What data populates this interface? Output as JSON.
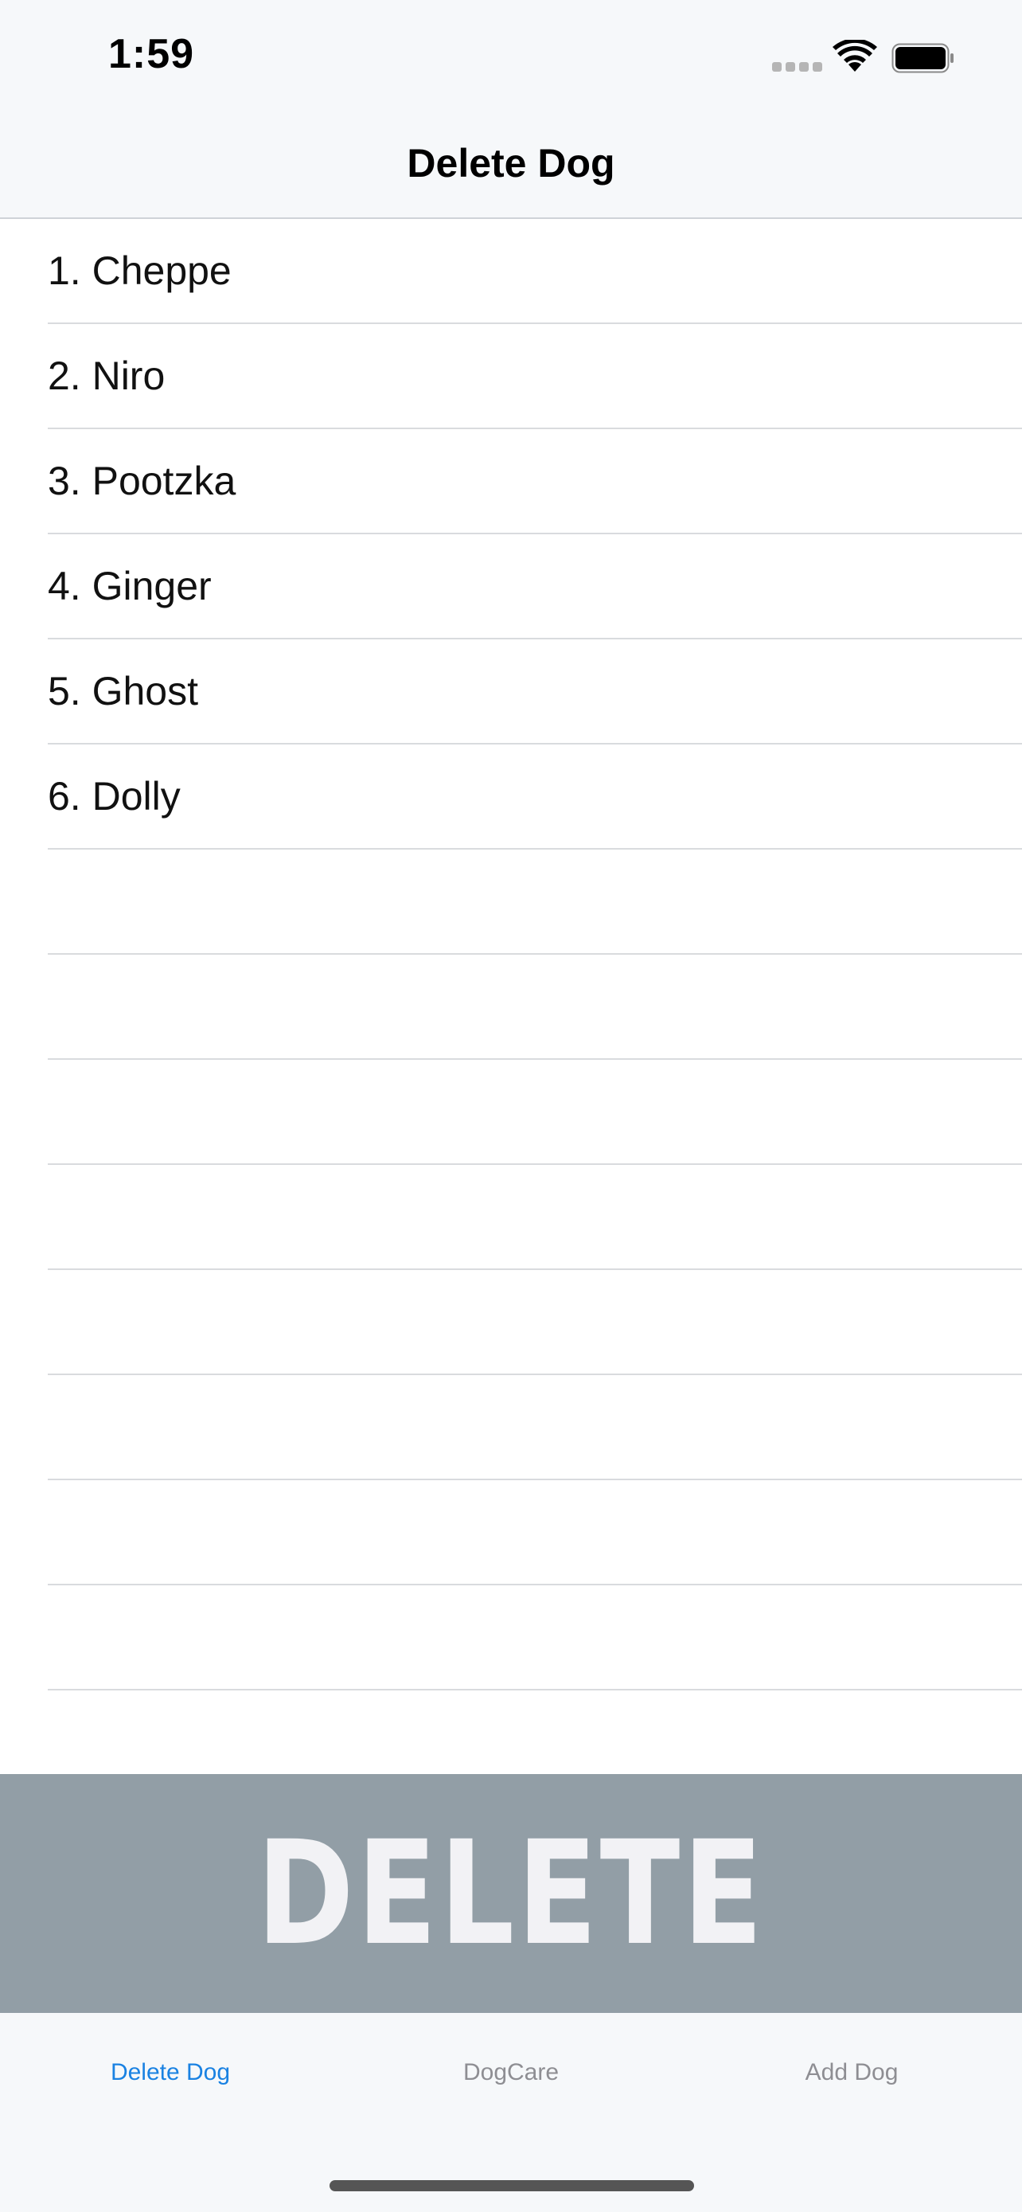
{
  "status_bar": {
    "time": "1:59"
  },
  "nav": {
    "title": "Delete Dog"
  },
  "dogs": [
    "1. Cheppe",
    "2. Niro",
    "3. Pootzka",
    "4. Ginger",
    "5. Ghost",
    "6. Dolly"
  ],
  "delete_banner": {
    "label": "DELETE"
  },
  "tab_bar": {
    "tabs": [
      {
        "label": "Delete Dog",
        "active": true
      },
      {
        "label": "DogCare",
        "active": false
      },
      {
        "label": "Add Dog",
        "active": false
      }
    ]
  },
  "colors": {
    "accent": "#1a82e2",
    "banner": "#929ea6",
    "bars": "#f6f8fa"
  }
}
